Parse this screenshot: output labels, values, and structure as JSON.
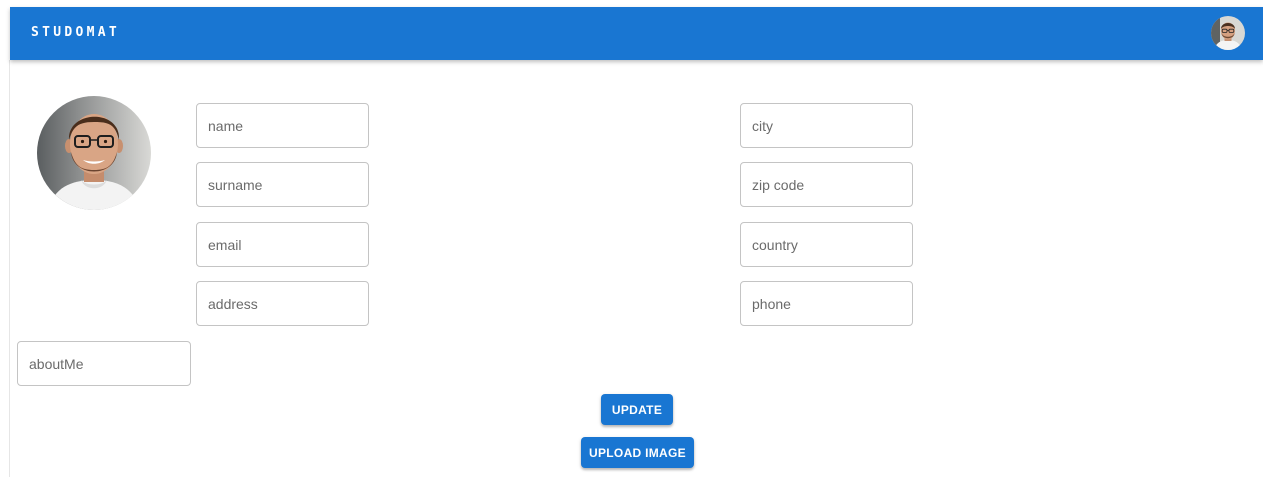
{
  "appbar": {
    "title": "STUDOMAT",
    "color": "#1976d2",
    "avatar_icon": "user-avatar-icon"
  },
  "profile": {
    "photo_icon": "profile-photo"
  },
  "form": {
    "left_fields": [
      {
        "key": "name",
        "placeholder": "name",
        "value": ""
      },
      {
        "key": "surname",
        "placeholder": "surname",
        "value": ""
      },
      {
        "key": "email",
        "placeholder": "email",
        "value": ""
      },
      {
        "key": "address",
        "placeholder": "address",
        "value": ""
      }
    ],
    "right_fields": [
      {
        "key": "city",
        "placeholder": "city",
        "value": ""
      },
      {
        "key": "zip",
        "placeholder": "zip code",
        "value": ""
      },
      {
        "key": "country",
        "placeholder": "country",
        "value": ""
      },
      {
        "key": "phone",
        "placeholder": "phone",
        "value": ""
      }
    ],
    "about": {
      "placeholder": "aboutMe",
      "value": ""
    }
  },
  "actions": {
    "update_label": "UPDATE",
    "upload_label": "UPLOAD IMAGE"
  }
}
